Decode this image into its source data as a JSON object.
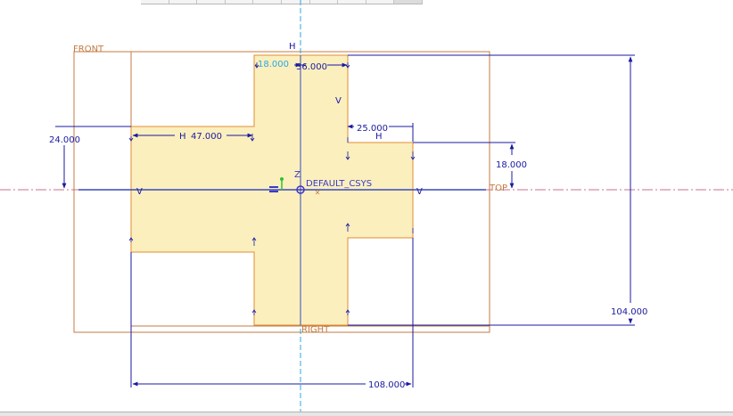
{
  "toolbar": {
    "button_count": 10
  },
  "datum_planes": {
    "front": "FRONT",
    "top": "TOP",
    "right": "RIGHT"
  },
  "csys": {
    "label": "DEFAULT_CSYS",
    "axis_label": "Z"
  },
  "constraints": {
    "horizontal": "H",
    "vertical": "V"
  },
  "dimensions": {
    "top_arm_half_width": "18.000",
    "top_arm_width": "36.000",
    "left_arm_length": "47.000",
    "right_arm_length": "25.000",
    "left_height": "24.000",
    "right_height": "18.000",
    "total_height": "104.000",
    "total_width": "108.000"
  },
  "colors": {
    "sketch_fill": "#fbefbe",
    "sketch_edge": "#e08c30",
    "datum": "#c47a40",
    "dimension": "#1a1aa0",
    "centerline_v": "#2ca8e0",
    "centerline_h": "#c87090",
    "csys": "#3a3ac8"
  }
}
